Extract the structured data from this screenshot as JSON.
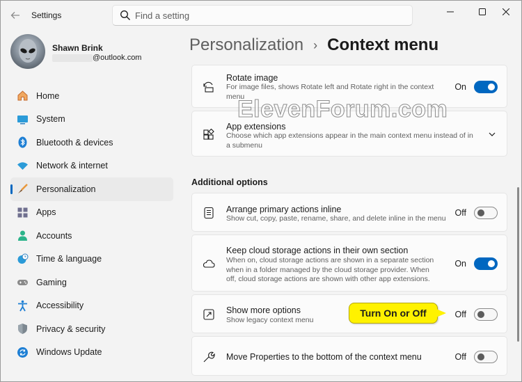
{
  "window": {
    "title": "Settings"
  },
  "search": {
    "placeholder": "Find a setting"
  },
  "profile": {
    "name": "Shawn Brink",
    "email_suffix": "@outlook.com"
  },
  "sidebar": {
    "items": [
      {
        "label": "Home",
        "icon": "home-icon"
      },
      {
        "label": "System",
        "icon": "monitor-icon"
      },
      {
        "label": "Bluetooth & devices",
        "icon": "bluetooth-icon"
      },
      {
        "label": "Network & internet",
        "icon": "wifi-icon"
      },
      {
        "label": "Personalization",
        "icon": "brush-icon",
        "active": true
      },
      {
        "label": "Apps",
        "icon": "apps-icon"
      },
      {
        "label": "Accounts",
        "icon": "person-icon"
      },
      {
        "label": "Time & language",
        "icon": "clock-globe-icon"
      },
      {
        "label": "Gaming",
        "icon": "gamepad-icon"
      },
      {
        "label": "Accessibility",
        "icon": "accessibility-icon"
      },
      {
        "label": "Privacy & security",
        "icon": "shield-icon"
      },
      {
        "label": "Windows Update",
        "icon": "update-icon"
      }
    ]
  },
  "breadcrumb": {
    "parent": "Personalization",
    "separator": "›",
    "current": "Context menu"
  },
  "settings": {
    "rotate_image": {
      "title": "Rotate image",
      "desc": "For image files, shows Rotate left and Rotate right in the context menu",
      "state": "On"
    },
    "app_extensions": {
      "title": "App extensions",
      "desc": "Choose which app extensions appear in the main context menu instead of in a submenu"
    },
    "additional_options_title": "Additional options",
    "arrange_inline": {
      "title": "Arrange primary actions inline",
      "desc": "Show cut, copy, paste, rename, share, and delete inline in the menu",
      "state": "Off"
    },
    "cloud_storage": {
      "title": "Keep cloud storage actions in their own section",
      "desc": "When on, cloud storage actions are shown in a separate section when in a folder managed by the cloud storage provider. When off, cloud storage actions are shown with other app extensions.",
      "state": "On"
    },
    "show_more": {
      "title": "Show more options",
      "desc": "Show legacy context menu",
      "state": "Off"
    },
    "move_properties": {
      "title": "Move Properties to the bottom of the context menu",
      "state": "Off"
    }
  },
  "annotations": {
    "watermark": "ElevenForum.com",
    "callout": "Turn On or Off"
  },
  "colors": {
    "accent": "#0067c0",
    "callout": "#fff200"
  }
}
